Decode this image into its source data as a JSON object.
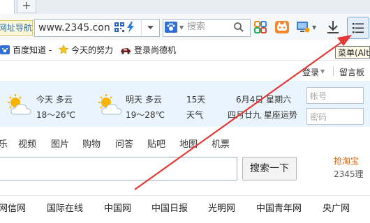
{
  "browser": {
    "new_tab_symbol": "+",
    "site_nav_label": "网址导航",
    "address": {
      "url_main": "www.2345.con",
      "url_hint": ""
    },
    "search": {
      "placeholder": "搜索"
    },
    "tooltip": "菜单(Alt+F)",
    "icons": [
      "qr-code-icon",
      "lightning-icon",
      "dropdown-arrow-icon",
      "paw-icon",
      "search-icon",
      "apps-icon",
      "game-icon",
      "screen-icon",
      "download-icon",
      "menu-icon"
    ]
  },
  "bookmarks": [
    {
      "label": "百度知道 -",
      "icon": "paw-icon"
    },
    {
      "label": "今天的努力",
      "icon": "star-icon"
    },
    {
      "label": "登录尚德机",
      "icon": "car-icon"
    }
  ],
  "page": {
    "login": {
      "login_label": "登录",
      "guestbook_label": "留言板"
    },
    "weather": {
      "today": {
        "day": "今天",
        "condition": "多云",
        "temp": "18～26℃"
      },
      "tomorrow": {
        "day": "明天",
        "condition": "多云",
        "temp": "19～28℃"
      },
      "forecast_15": {
        "line1": "15天",
        "line2": "天气"
      },
      "date": {
        "line1": "6月4日 星期六",
        "line2": "四月廿九 星座运势"
      }
    },
    "login_form": {
      "account_placeholder": "帐号",
      "password_placeholder": "密码"
    },
    "search_tabs": [
      "乐",
      "视频",
      "图片",
      "购物",
      "问答",
      "贴吧",
      "地图",
      "机票"
    ],
    "search_button": "搜索一下",
    "promo": {
      "line1": "抢淘宝",
      "line2": "2345理"
    },
    "links": [
      "网信网",
      "国际在线",
      "中国网",
      "中国日报",
      "光明网",
      "中国青年网",
      "央广网"
    ]
  },
  "colors": {
    "accent": "#e53935",
    "link_blue": "#2d6db3",
    "weather_bg": "#eaf4fc",
    "promo_orange": "#d06410"
  }
}
